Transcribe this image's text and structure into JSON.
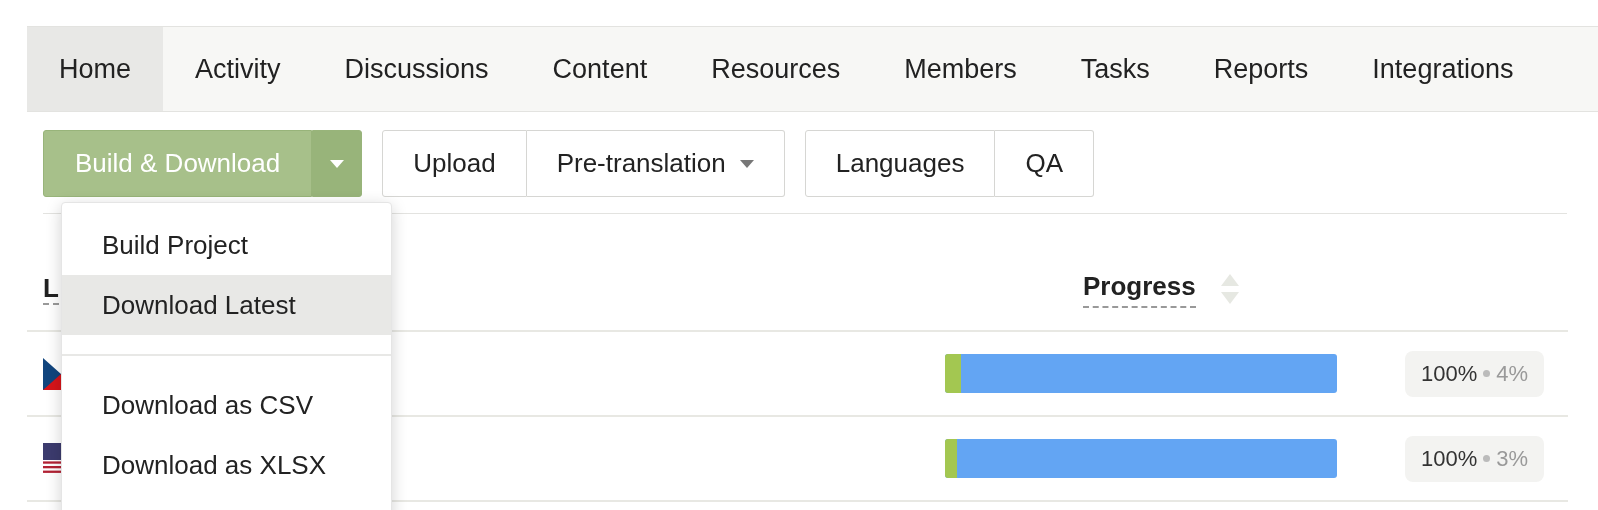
{
  "tabs": [
    {
      "label": "Home",
      "selected": true
    },
    {
      "label": "Activity",
      "selected": false
    },
    {
      "label": "Discussions",
      "selected": false
    },
    {
      "label": "Content",
      "selected": false
    },
    {
      "label": "Resources",
      "selected": false
    },
    {
      "label": "Members",
      "selected": false
    },
    {
      "label": "Tasks",
      "selected": false
    },
    {
      "label": "Reports",
      "selected": false
    },
    {
      "label": "Integrations",
      "selected": false
    }
  ],
  "toolbar": {
    "primary": {
      "label": "Build & Download",
      "expanded": true
    },
    "groups": [
      [
        {
          "label": "Upload",
          "kind": "button"
        },
        {
          "label": "Pre-translation",
          "kind": "dropdown"
        }
      ],
      [
        {
          "label": "Languages",
          "kind": "button"
        },
        {
          "label": "QA",
          "kind": "button"
        }
      ]
    ]
  },
  "menu": {
    "items": [
      {
        "label": "Build Project",
        "kind": "item",
        "selected": false
      },
      {
        "label": "Download Latest",
        "kind": "item",
        "selected": true
      },
      {
        "kind": "divider"
      },
      {
        "label": "Download as CSV",
        "kind": "item",
        "selected": false
      },
      {
        "label": "Download as XLSX",
        "kind": "item",
        "selected": false
      }
    ]
  },
  "table": {
    "columns": [
      {
        "label": "L"
      },
      {
        "label": "Progress"
      }
    ],
    "rows": [
      {
        "translated": {
          "level": 1.0
        },
        "approved": {
          "level": 0.04
        },
        "translated_text": "100%",
        "approved_text": "4%"
      },
      {
        "translated": {
          "level": 1.0
        },
        "approved": {
          "level": 0.03
        },
        "translated_text": "100%",
        "approved_text": "3%"
      }
    ]
  }
}
